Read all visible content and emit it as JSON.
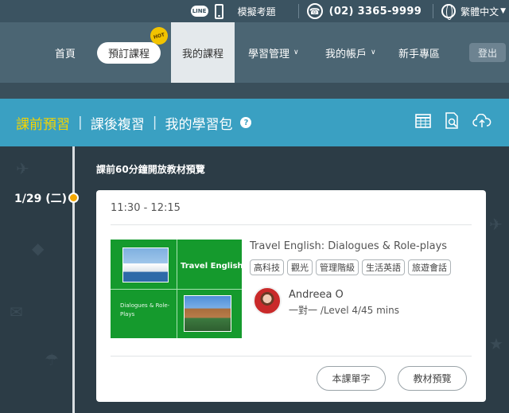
{
  "topbar": {
    "line_label": "LINE",
    "mock_exam": "模擬考題",
    "phone": "(02) 3365-9999",
    "language": "繁體中文"
  },
  "nav": {
    "home": "首頁",
    "book": "預訂課程",
    "hot_badge": "HOT",
    "my_courses": "我的課程",
    "learning_mgmt": "學習管理",
    "my_account": "我的帳戶",
    "newbie": "新手專區",
    "logout": "登出"
  },
  "tabs": {
    "preview": "課前預習",
    "review": "課後複習",
    "package": "我的學習包"
  },
  "timeline": {
    "notice": "課前60分鐘開放教材預覽",
    "date": "1/29 (二)"
  },
  "lesson": {
    "time": "11:30 - 12:15",
    "thumb_title": "Travel English",
    "thumb_subtitle": "Dialogues & Role-Plays",
    "title": "Travel English: Dialogues & Role-plays",
    "tags": [
      "高科技",
      "觀光",
      "管理階級",
      "生活英語",
      "旅遊會話"
    ],
    "teacher": "Andreea O",
    "info": "一對一 /Level 4/45 mins",
    "vocab_button": "本課單字",
    "preview_button": "教材預覽"
  },
  "colors": {
    "accent": "#3aa0c2",
    "active_tab": "#f5d400",
    "timeline_dot": "#f5a800"
  }
}
